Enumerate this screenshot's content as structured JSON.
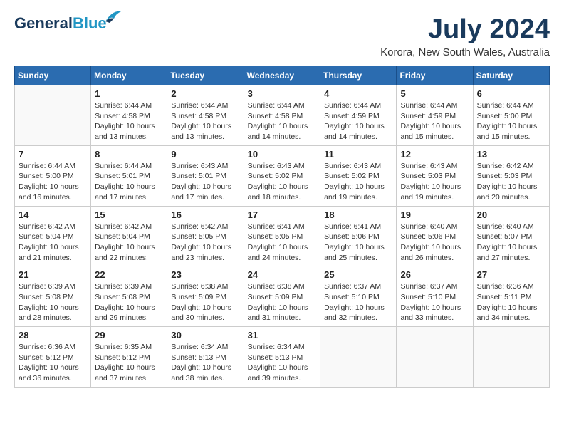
{
  "header": {
    "logo_general": "General",
    "logo_blue": "Blue",
    "month_year": "July 2024",
    "location": "Korora, New South Wales, Australia"
  },
  "weekdays": [
    "Sunday",
    "Monday",
    "Tuesday",
    "Wednesday",
    "Thursday",
    "Friday",
    "Saturday"
  ],
  "weeks": [
    [
      {
        "day": "",
        "info": ""
      },
      {
        "day": "1",
        "info": "Sunrise: 6:44 AM\nSunset: 4:58 PM\nDaylight: 10 hours\nand 13 minutes."
      },
      {
        "day": "2",
        "info": "Sunrise: 6:44 AM\nSunset: 4:58 PM\nDaylight: 10 hours\nand 13 minutes."
      },
      {
        "day": "3",
        "info": "Sunrise: 6:44 AM\nSunset: 4:58 PM\nDaylight: 10 hours\nand 14 minutes."
      },
      {
        "day": "4",
        "info": "Sunrise: 6:44 AM\nSunset: 4:59 PM\nDaylight: 10 hours\nand 14 minutes."
      },
      {
        "day": "5",
        "info": "Sunrise: 6:44 AM\nSunset: 4:59 PM\nDaylight: 10 hours\nand 15 minutes."
      },
      {
        "day": "6",
        "info": "Sunrise: 6:44 AM\nSunset: 5:00 PM\nDaylight: 10 hours\nand 15 minutes."
      }
    ],
    [
      {
        "day": "7",
        "info": "Sunrise: 6:44 AM\nSunset: 5:00 PM\nDaylight: 10 hours\nand 16 minutes."
      },
      {
        "day": "8",
        "info": "Sunrise: 6:44 AM\nSunset: 5:01 PM\nDaylight: 10 hours\nand 17 minutes."
      },
      {
        "day": "9",
        "info": "Sunrise: 6:43 AM\nSunset: 5:01 PM\nDaylight: 10 hours\nand 17 minutes."
      },
      {
        "day": "10",
        "info": "Sunrise: 6:43 AM\nSunset: 5:02 PM\nDaylight: 10 hours\nand 18 minutes."
      },
      {
        "day": "11",
        "info": "Sunrise: 6:43 AM\nSunset: 5:02 PM\nDaylight: 10 hours\nand 19 minutes."
      },
      {
        "day": "12",
        "info": "Sunrise: 6:43 AM\nSunset: 5:03 PM\nDaylight: 10 hours\nand 19 minutes."
      },
      {
        "day": "13",
        "info": "Sunrise: 6:42 AM\nSunset: 5:03 PM\nDaylight: 10 hours\nand 20 minutes."
      }
    ],
    [
      {
        "day": "14",
        "info": "Sunrise: 6:42 AM\nSunset: 5:04 PM\nDaylight: 10 hours\nand 21 minutes."
      },
      {
        "day": "15",
        "info": "Sunrise: 6:42 AM\nSunset: 5:04 PM\nDaylight: 10 hours\nand 22 minutes."
      },
      {
        "day": "16",
        "info": "Sunrise: 6:42 AM\nSunset: 5:05 PM\nDaylight: 10 hours\nand 23 minutes."
      },
      {
        "day": "17",
        "info": "Sunrise: 6:41 AM\nSunset: 5:05 PM\nDaylight: 10 hours\nand 24 minutes."
      },
      {
        "day": "18",
        "info": "Sunrise: 6:41 AM\nSunset: 5:06 PM\nDaylight: 10 hours\nand 25 minutes."
      },
      {
        "day": "19",
        "info": "Sunrise: 6:40 AM\nSunset: 5:06 PM\nDaylight: 10 hours\nand 26 minutes."
      },
      {
        "day": "20",
        "info": "Sunrise: 6:40 AM\nSunset: 5:07 PM\nDaylight: 10 hours\nand 27 minutes."
      }
    ],
    [
      {
        "day": "21",
        "info": "Sunrise: 6:39 AM\nSunset: 5:08 PM\nDaylight: 10 hours\nand 28 minutes."
      },
      {
        "day": "22",
        "info": "Sunrise: 6:39 AM\nSunset: 5:08 PM\nDaylight: 10 hours\nand 29 minutes."
      },
      {
        "day": "23",
        "info": "Sunrise: 6:38 AM\nSunset: 5:09 PM\nDaylight: 10 hours\nand 30 minutes."
      },
      {
        "day": "24",
        "info": "Sunrise: 6:38 AM\nSunset: 5:09 PM\nDaylight: 10 hours\nand 31 minutes."
      },
      {
        "day": "25",
        "info": "Sunrise: 6:37 AM\nSunset: 5:10 PM\nDaylight: 10 hours\nand 32 minutes."
      },
      {
        "day": "26",
        "info": "Sunrise: 6:37 AM\nSunset: 5:10 PM\nDaylight: 10 hours\nand 33 minutes."
      },
      {
        "day": "27",
        "info": "Sunrise: 6:36 AM\nSunset: 5:11 PM\nDaylight: 10 hours\nand 34 minutes."
      }
    ],
    [
      {
        "day": "28",
        "info": "Sunrise: 6:36 AM\nSunset: 5:12 PM\nDaylight: 10 hours\nand 36 minutes."
      },
      {
        "day": "29",
        "info": "Sunrise: 6:35 AM\nSunset: 5:12 PM\nDaylight: 10 hours\nand 37 minutes."
      },
      {
        "day": "30",
        "info": "Sunrise: 6:34 AM\nSunset: 5:13 PM\nDaylight: 10 hours\nand 38 minutes."
      },
      {
        "day": "31",
        "info": "Sunrise: 6:34 AM\nSunset: 5:13 PM\nDaylight: 10 hours\nand 39 minutes."
      },
      {
        "day": "",
        "info": ""
      },
      {
        "day": "",
        "info": ""
      },
      {
        "day": "",
        "info": ""
      }
    ]
  ]
}
